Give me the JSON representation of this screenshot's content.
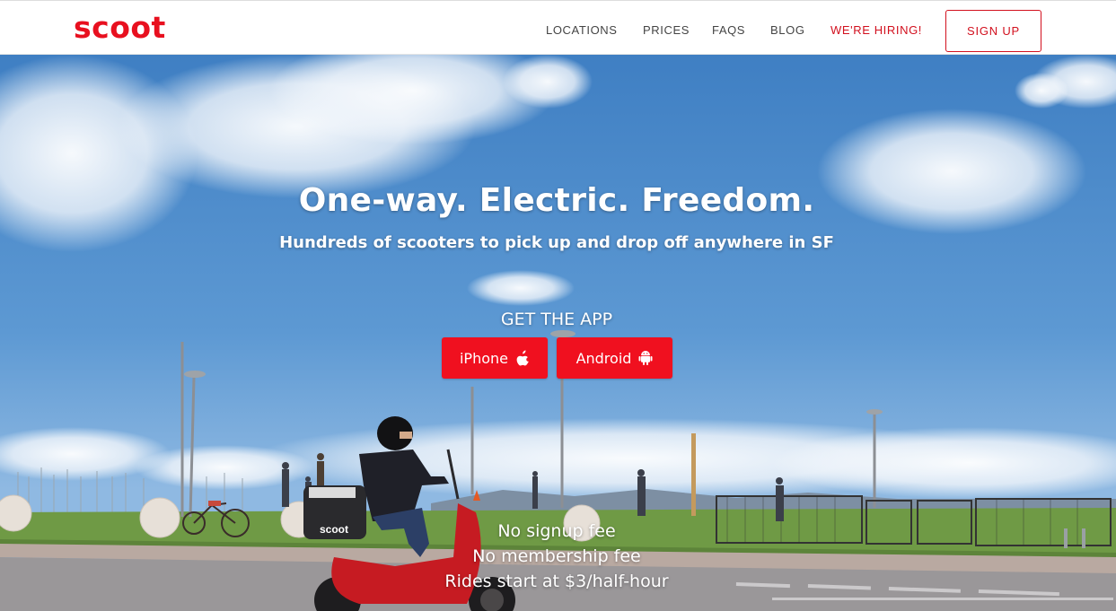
{
  "nav": {
    "logo": "scoot",
    "links": [
      {
        "label": "LOCATIONS"
      },
      {
        "label": "PRICES"
      },
      {
        "label": "FAQS"
      },
      {
        "label": "BLOG"
      },
      {
        "label": "WE'RE HIRING!"
      }
    ],
    "signup_label": "SIGN UP"
  },
  "hero": {
    "title": "One-way. Electric. Freedom.",
    "subtitle": "Hundreds of scooters to pick up and drop off anywhere in SF",
    "get_app_label": "GET THE APP",
    "buttons": {
      "iphone": {
        "label": "iPhone",
        "icon": "apple-icon"
      },
      "android": {
        "label": "Android",
        "icon": "android-icon"
      }
    },
    "features": [
      "No signup fee",
      "No membership fee",
      "Rides start at $3/half-hour"
    ],
    "scooter_box_label": "scoot"
  },
  "colors": {
    "brand_red": "#e8101f",
    "sky_blue": "#4a86c6",
    "grass_green": "#6f9a45"
  }
}
